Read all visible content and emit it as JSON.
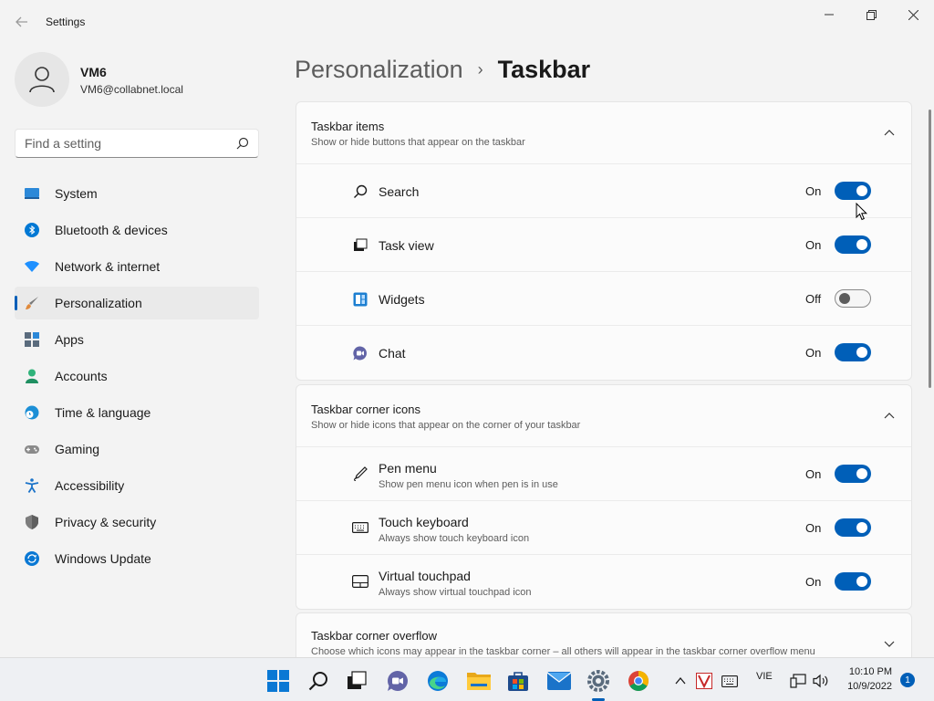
{
  "window": {
    "title": "Settings",
    "back_icon": "back-arrow-icon",
    "minimize_icon": "minimize-icon",
    "maximize_icon": "maximize-icon",
    "close_icon": "close-icon"
  },
  "profile": {
    "name": "VM6",
    "email": "VM6@collabnet.local",
    "avatar_icon": "person-icon"
  },
  "search": {
    "placeholder": "Find a setting",
    "icon": "search-icon"
  },
  "sidebar": {
    "items": [
      {
        "label": "System",
        "icon": "system-icon",
        "color": "#2b88d8"
      },
      {
        "label": "Bluetooth & devices",
        "icon": "bluetooth-icon",
        "color": "#0078d4"
      },
      {
        "label": "Network & internet",
        "icon": "wifi-icon",
        "color": "#1e90ff"
      },
      {
        "label": "Personalization",
        "icon": "brush-icon",
        "color": "#e08a3c",
        "active": true
      },
      {
        "label": "Apps",
        "icon": "apps-icon",
        "color": "#5a6b7d"
      },
      {
        "label": "Accounts",
        "icon": "accounts-icon",
        "color": "#2fb37a"
      },
      {
        "label": "Time & language",
        "icon": "globe-clock-icon",
        "color": "#1c8fd6"
      },
      {
        "label": "Gaming",
        "icon": "gamepad-icon",
        "color": "#707070"
      },
      {
        "label": "Accessibility",
        "icon": "accessibility-icon",
        "color": "#1a73c9"
      },
      {
        "label": "Privacy & security",
        "icon": "shield-icon",
        "color": "#6b6b6b"
      },
      {
        "label": "Windows Update",
        "icon": "update-icon",
        "color": "#0a78d4"
      }
    ]
  },
  "breadcrumb": {
    "parent": "Personalization",
    "separator": "›",
    "current": "Taskbar"
  },
  "groups": [
    {
      "title": "Taskbar items",
      "desc": "Show or hide buttons that appear on the taskbar",
      "expanded": true,
      "rows": [
        {
          "label": "Search",
          "icon": "search-icon",
          "state": "On",
          "on": true
        },
        {
          "label": "Task view",
          "icon": "task-view-icon",
          "state": "On",
          "on": true
        },
        {
          "label": "Widgets",
          "icon": "widgets-icon",
          "state": "Off",
          "on": false
        },
        {
          "label": "Chat",
          "icon": "chat-icon",
          "state": "On",
          "on": true
        }
      ]
    },
    {
      "title": "Taskbar corner icons",
      "desc": "Show or hide icons that appear on the corner of your taskbar",
      "expanded": true,
      "rows": [
        {
          "label": "Pen menu",
          "desc": "Show pen menu icon when pen is in use",
          "icon": "pen-icon",
          "state": "On",
          "on": true
        },
        {
          "label": "Touch keyboard",
          "desc": "Always show touch keyboard icon",
          "icon": "keyboard-icon",
          "state": "On",
          "on": true
        },
        {
          "label": "Virtual touchpad",
          "desc": "Always show virtual touchpad icon",
          "icon": "touchpad-icon",
          "state": "On",
          "on": true
        }
      ]
    }
  ],
  "overflow_group": {
    "title": "Taskbar corner overflow",
    "desc": "Choose which icons may appear in the taskbar corner – all others will appear in the taskbar corner overflow menu",
    "expanded": false
  },
  "taskbar": {
    "apps": [
      "windows-start-icon",
      "search-icon",
      "task-view-icon",
      "chat-icon",
      "edge-icon",
      "file-explorer-icon",
      "store-icon",
      "mail-icon",
      "settings-icon",
      "chrome-icon"
    ],
    "tray": {
      "language": "VIE",
      "time": "10:10 PM",
      "date": "10/9/2022",
      "notifications": "1"
    }
  },
  "colors": {
    "accent": "#005fb8",
    "background": "#f3f3f3",
    "card": "#fbfbfb"
  }
}
